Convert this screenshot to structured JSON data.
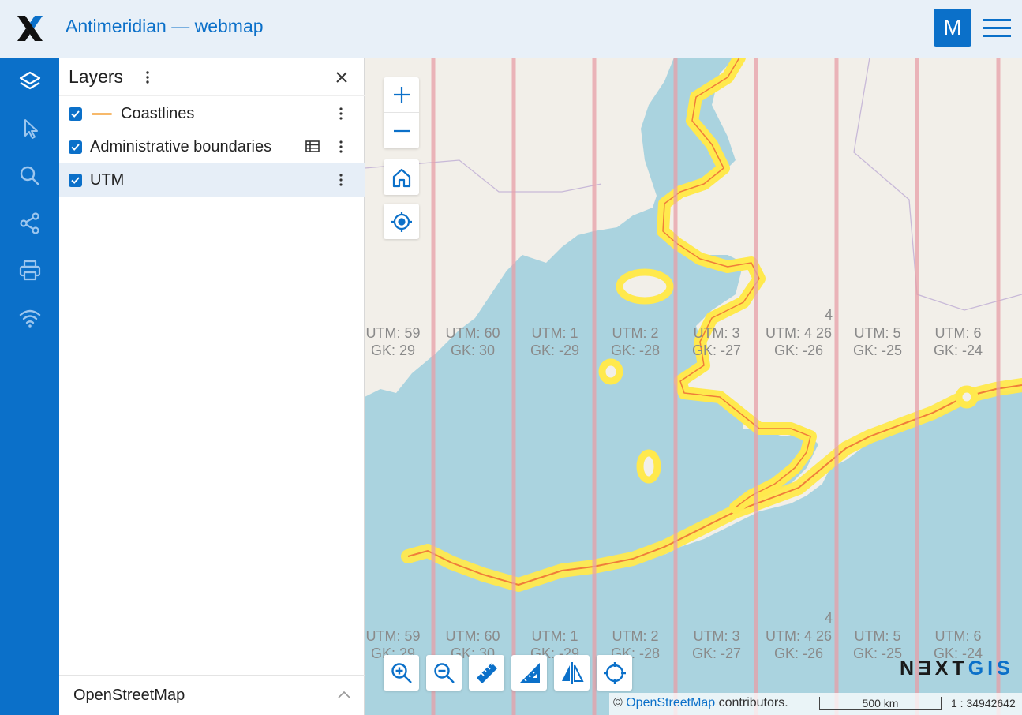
{
  "header": {
    "app_title": "Antimeridian — webmap",
    "user_initial": "M"
  },
  "rail": {
    "items": [
      "layers-icon",
      "cursor-icon",
      "search-icon",
      "share-icon",
      "print-icon",
      "wifi-icon"
    ]
  },
  "layers_panel": {
    "title": "Layers",
    "layers": [
      {
        "label": "Coastlines",
        "checked": true,
        "legend_color": "#f7b96b"
      },
      {
        "label": "Administrative boundaries",
        "checked": true
      },
      {
        "label": "UTM",
        "checked": true
      }
    ],
    "basemap": "OpenStreetMap"
  },
  "map": {
    "utm_top": [
      {
        "utm": "UTM: 59",
        "gk": "GK: 29"
      },
      {
        "utm": "UTM: 60",
        "gk": "GK: 30"
      },
      {
        "utm": "UTM: 1",
        "gk": "GK: -29"
      },
      {
        "utm": "UTM: 2",
        "gk": "GK: -28"
      },
      {
        "utm": "UTM: 3",
        "gk": "GK: -27"
      },
      {
        "utm": "UTM: 4 26",
        "gk": "GK: -26"
      },
      {
        "utm": "UTM: 5",
        "gk": "GK: -25"
      },
      {
        "utm": "UTM: 6",
        "gk": "GK: -24"
      }
    ],
    "utm_bottom": [
      {
        "utm": "UTM: 59",
        "gk": "GK: 29"
      },
      {
        "utm": "UTM: 60",
        "gk": "GK: 30"
      },
      {
        "utm": "UTM: 1",
        "gk": "GK: -29"
      },
      {
        "utm": "UTM: 2",
        "gk": "GK: -28"
      },
      {
        "utm": "UTM: 3",
        "gk": "GK: -27"
      },
      {
        "utm": "UTM: 4 26",
        "gk": "GK: -26"
      },
      {
        "utm": "UTM: 5",
        "gk": "GK: -25"
      },
      {
        "utm": "UTM: 6",
        "gk": "GK: -24"
      }
    ],
    "stray_labels": [
      "4",
      "4"
    ],
    "brand_part1": "NƎXT",
    "brand_part2": "GIS",
    "attribution_prefix": "© ",
    "attribution_link": "OpenStreetMap",
    "attribution_suffix": " contributors.",
    "scale_label": "500 km",
    "scale_ratio": "1 : 34942642",
    "colors": {
      "water": "#aad3df",
      "land": "#f2efe9",
      "coast_highlight": "#ffe94d",
      "coast_outline": "#f7b96b",
      "utm_line": "#e8a0a8",
      "accent": "#0b70c9"
    }
  }
}
